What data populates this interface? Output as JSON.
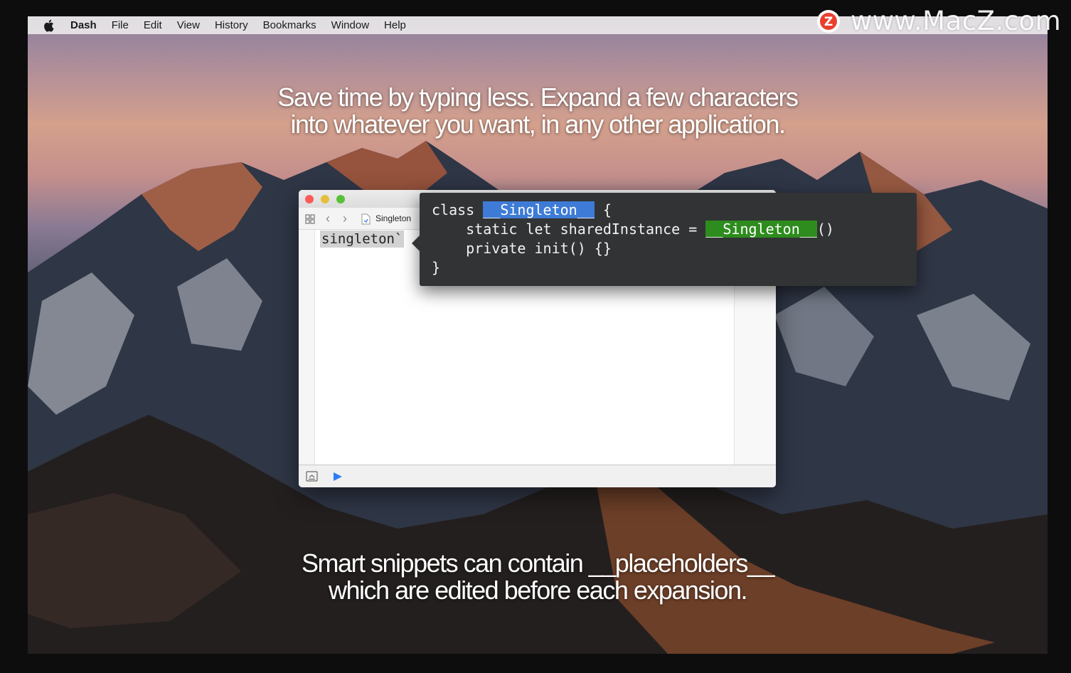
{
  "menubar": {
    "app_name": "Dash",
    "items": [
      "File",
      "Edit",
      "View",
      "History",
      "Bookmarks",
      "Window",
      "Help"
    ]
  },
  "watermark": {
    "text": "www.MacZ.com",
    "logo_letter": "Z"
  },
  "captions": {
    "top_line1": "Save time by typing less. Expand a few characters",
    "top_line2": "into whatever you want, in any other application.",
    "bottom_line1": "Smart snippets can contain __placeholders__",
    "bottom_line2": "which are edited before each expansion."
  },
  "editor": {
    "breadcrumb": "Singleton",
    "typed_text": "singleton`"
  },
  "snippet": {
    "line1_prefix": "class ",
    "placeholder": "__Singleton__",
    "line1_suffix": " {",
    "line2_prefix": "    static let sharedInstance = ",
    "line2_suffix": "()",
    "line3": "    private init() {}",
    "line4": "}"
  },
  "colors": {
    "placeholder_active": "#3e7bd6",
    "placeholder_linked": "#2d8c1d",
    "popup_bg": "#323334",
    "run_button": "#2e7cf6"
  }
}
